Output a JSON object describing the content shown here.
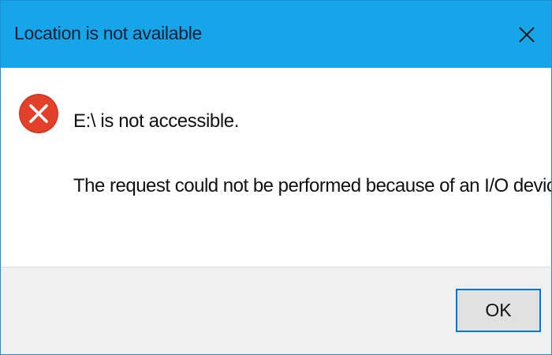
{
  "window": {
    "title": "Location is not available",
    "close_icon": "close-icon"
  },
  "message": {
    "icon": "error-icon",
    "primary": "E:\\ is not accessible.",
    "secondary": "The request could not be performed because of an I/O device error."
  },
  "buttons": {
    "ok_label": "OK"
  },
  "colors": {
    "titlebar": "#16a5e8",
    "error_icon": "#e3402b",
    "button_border": "#0078d7",
    "footer": "#f0f0f0"
  }
}
